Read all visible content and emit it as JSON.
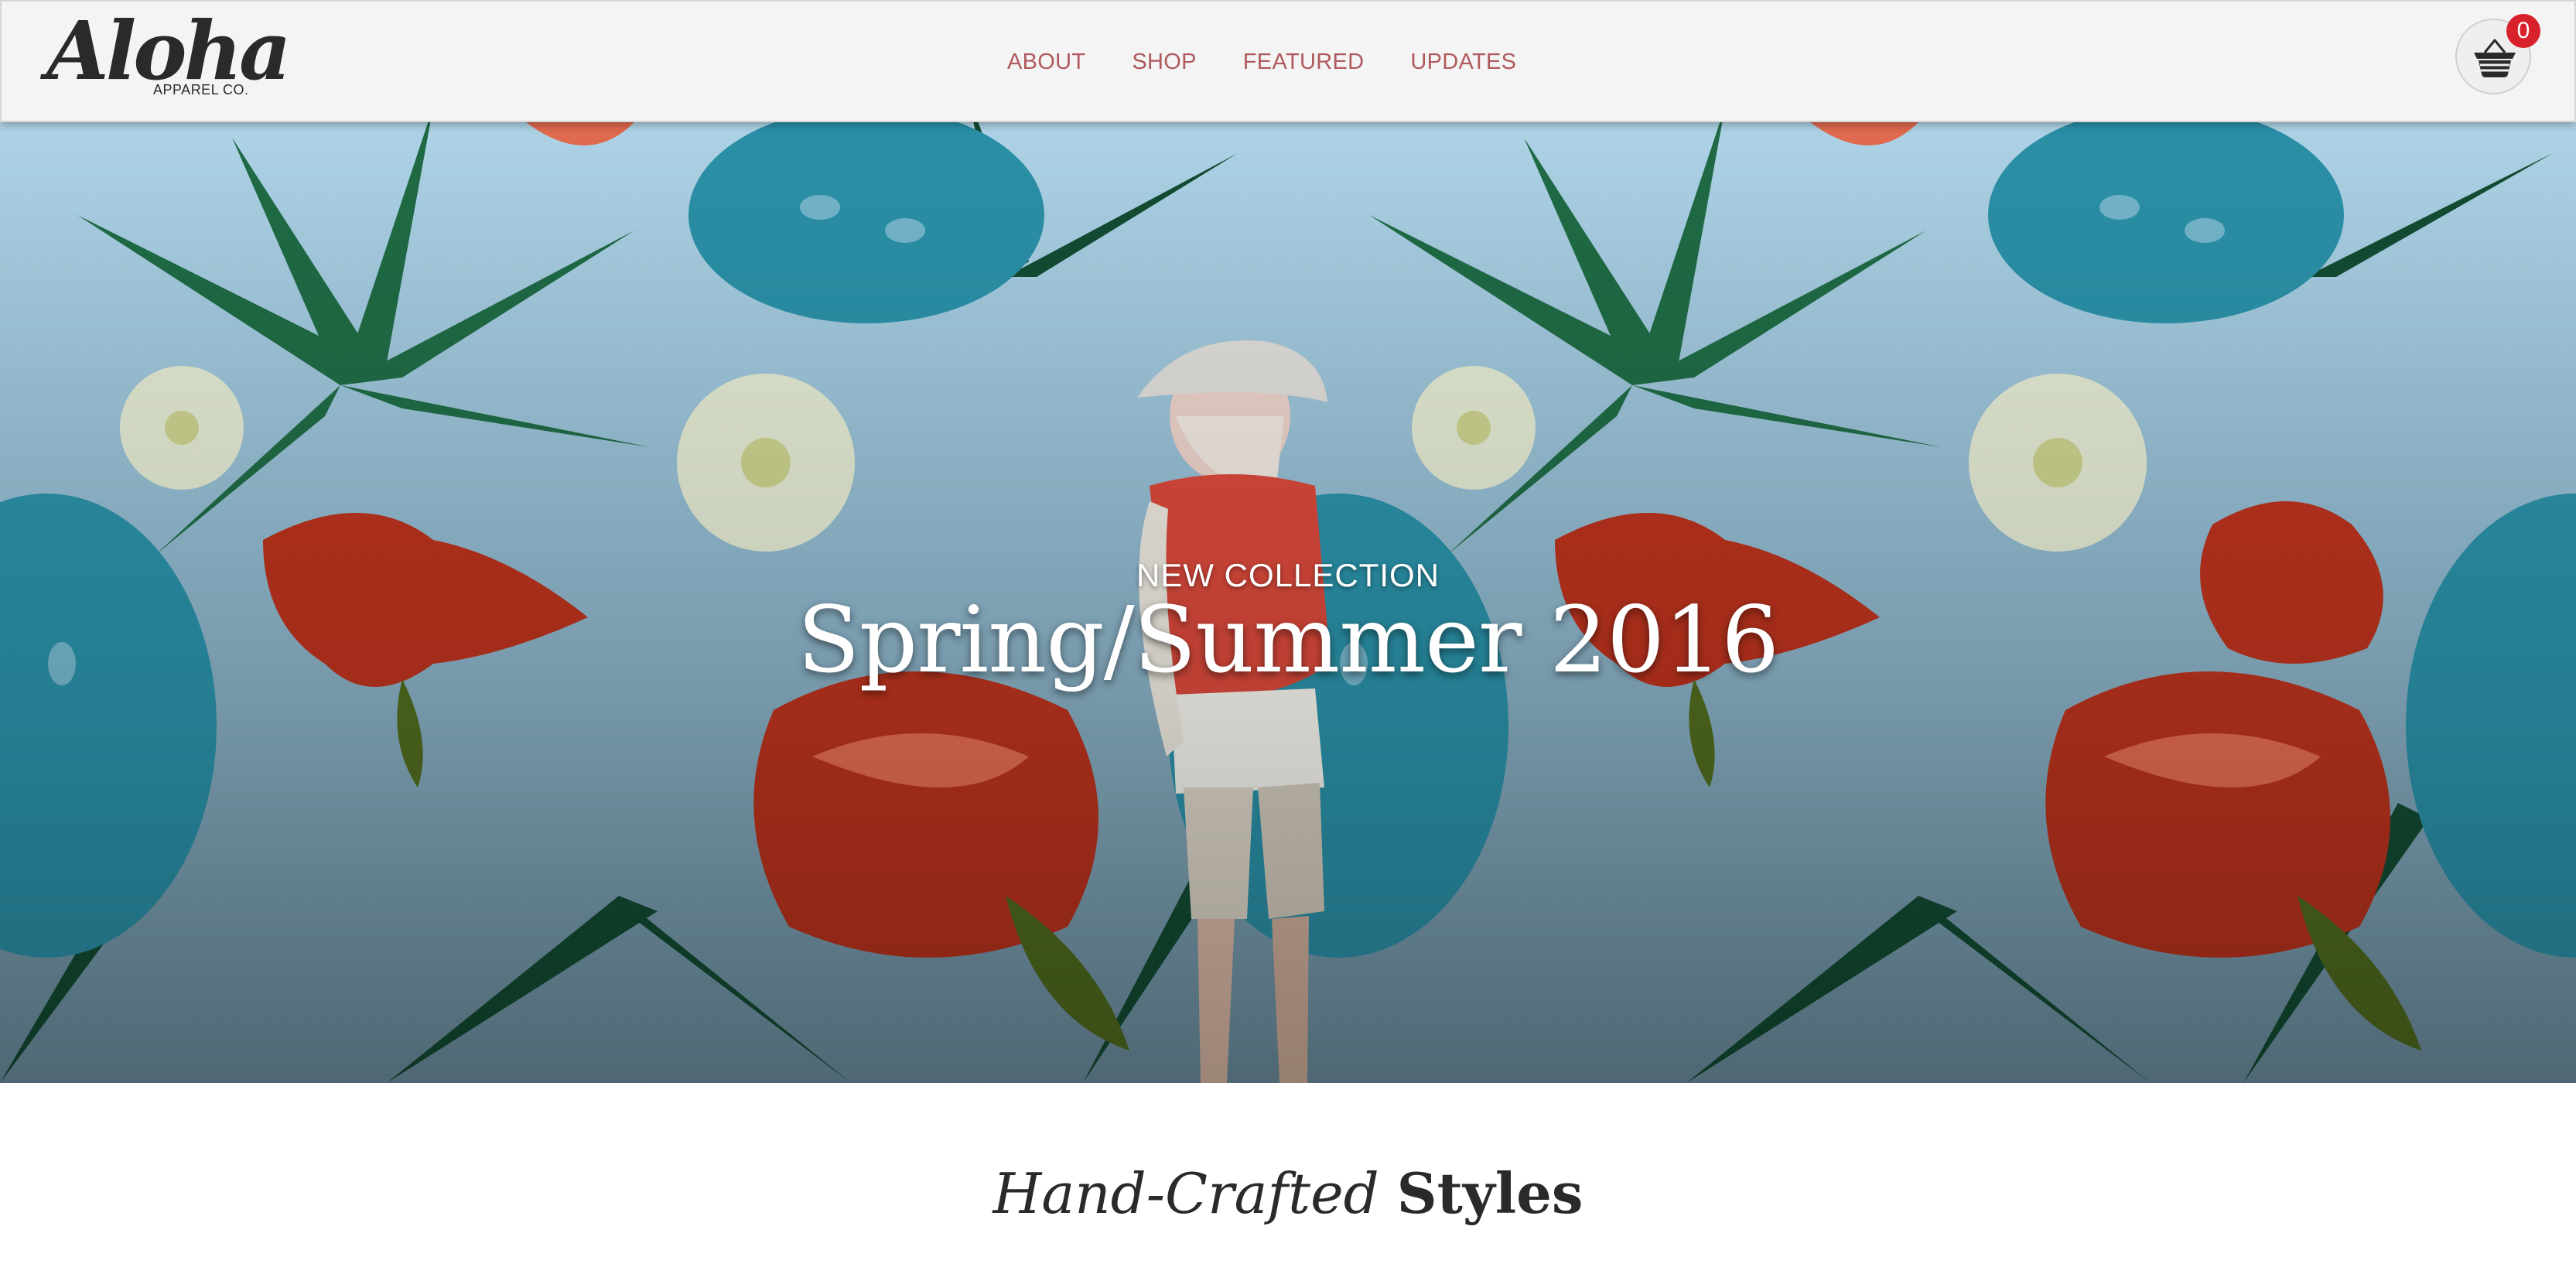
{
  "header": {
    "logo_script": "Aloha",
    "logo_sub": "APPAREL CO.",
    "nav": [
      {
        "label": "ABOUT"
      },
      {
        "label": "SHOP"
      },
      {
        "label": "FEATURED"
      },
      {
        "label": "UPDATES"
      }
    ],
    "cart_count": "0",
    "cart_icon": "shopping-basket-icon"
  },
  "hero": {
    "eyebrow": "NEW COLLECTION",
    "title": "Spring/Summer 2016"
  },
  "intro": {
    "title_italic": "Hand-Crafted",
    "title_bold": "Styles",
    "text": ""
  },
  "colors": {
    "nav_text": "#b05a5e",
    "badge": "#d9212b",
    "header_bg": "#f4f4f4"
  }
}
